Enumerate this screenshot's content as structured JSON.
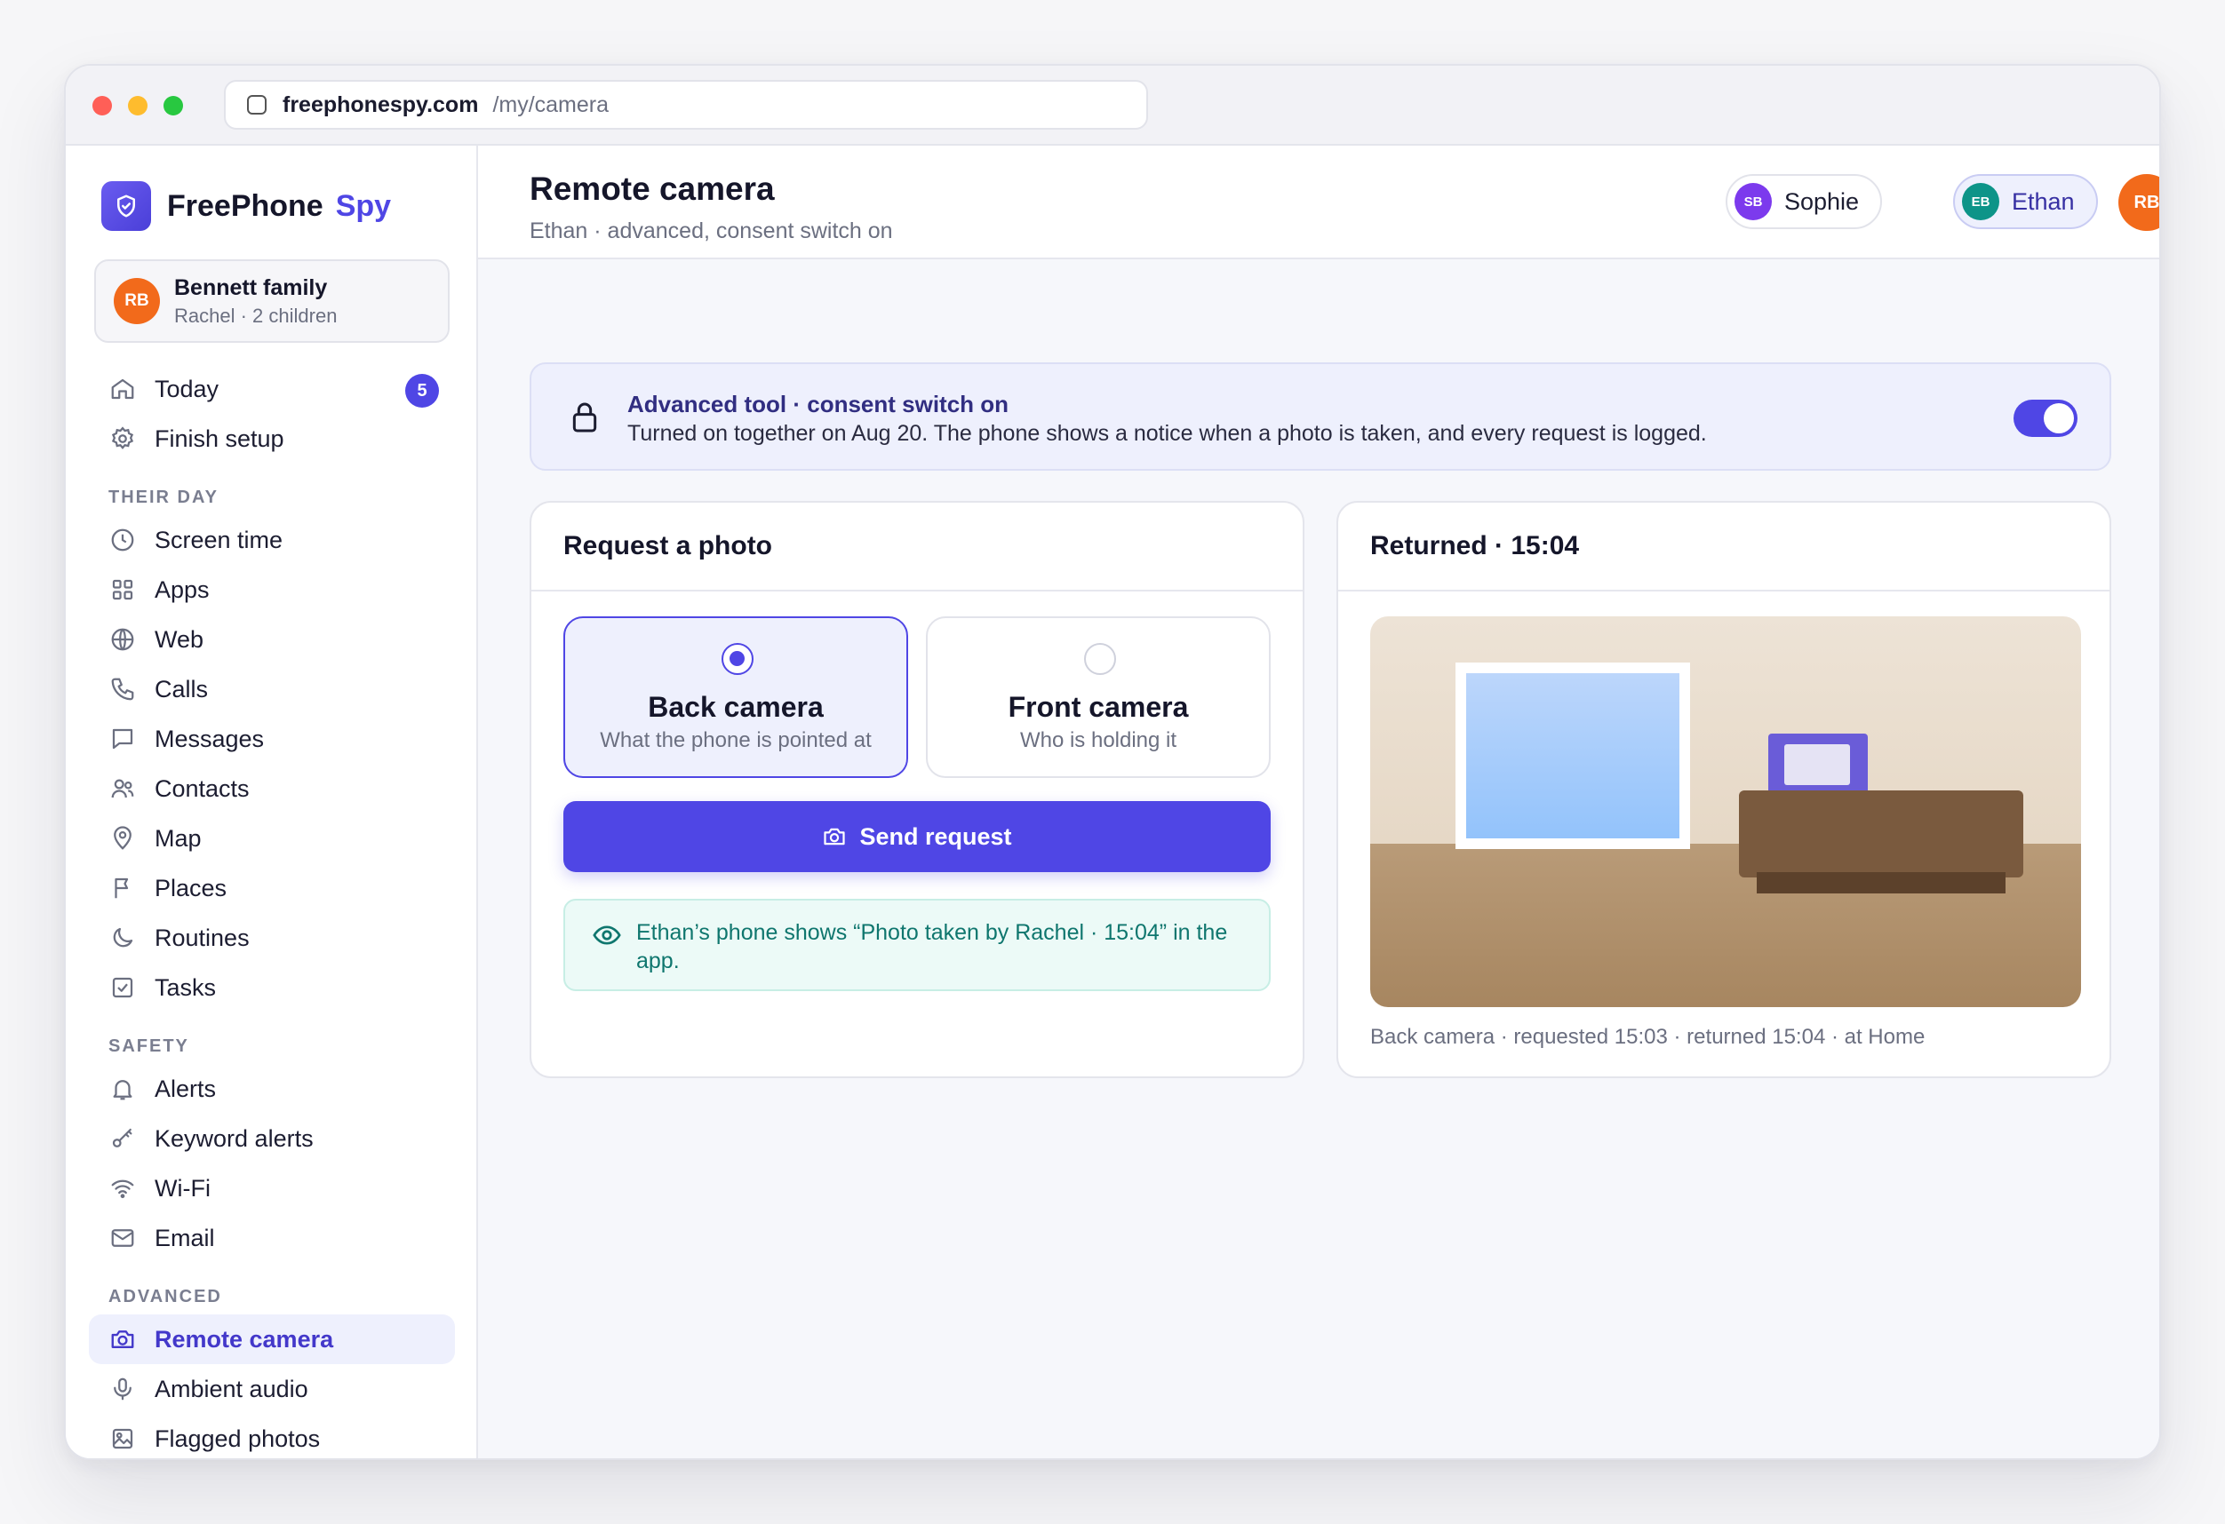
{
  "browser": {
    "host": "freephonespy.com",
    "path": "/my/camera"
  },
  "brand": {
    "name": "FreePhone",
    "accent_word": "Spy",
    "accent_color": "#4f46e5"
  },
  "family": {
    "initials": "RB",
    "name": "Bennett family",
    "detail": "Rachel · 2 children"
  },
  "nav": {
    "top": [
      {
        "label": "Today",
        "icon": "home-icon",
        "badge": "5"
      },
      {
        "label": "Finish setup",
        "icon": "gear-icon"
      }
    ],
    "sections": [
      {
        "title": "THEIR DAY",
        "items": [
          {
            "label": "Screen time",
            "icon": "clock-icon"
          },
          {
            "label": "Apps",
            "icon": "grid-icon"
          },
          {
            "label": "Web",
            "icon": "globe-icon"
          },
          {
            "label": "Calls",
            "icon": "phone-icon"
          },
          {
            "label": "Messages",
            "icon": "message-icon"
          },
          {
            "label": "Contacts",
            "icon": "users-icon"
          },
          {
            "label": "Map",
            "icon": "map-pin-icon"
          },
          {
            "label": "Places",
            "icon": "flag-icon"
          },
          {
            "label": "Routines",
            "icon": "moon-icon"
          },
          {
            "label": "Tasks",
            "icon": "checkbox-icon"
          }
        ]
      },
      {
        "title": "SAFETY",
        "items": [
          {
            "label": "Alerts",
            "icon": "bell-icon"
          },
          {
            "label": "Keyword alerts",
            "icon": "key-icon"
          },
          {
            "label": "Wi-Fi",
            "icon": "wifi-icon"
          },
          {
            "label": "Email",
            "icon": "mail-icon"
          }
        ]
      },
      {
        "title": "ADVANCED",
        "items": [
          {
            "label": "Remote camera",
            "icon": "camera-icon",
            "active": true
          },
          {
            "label": "Ambient audio",
            "icon": "microphone-icon"
          },
          {
            "label": "Flagged photos",
            "icon": "image-icon"
          }
        ]
      }
    ]
  },
  "header": {
    "title": "Remote camera",
    "subtitle": "Ethan · advanced, consent switch on",
    "profiles": [
      {
        "initials": "SB",
        "name": "Sophie"
      },
      {
        "initials": "EB",
        "name": "Ethan",
        "selected": true
      }
    ],
    "user_initials": "RB"
  },
  "consent": {
    "title": "Advanced tool · consent switch on",
    "text": "Turned on together on Aug 20. The phone shows a notice when a photo is taken, and every request is logged.",
    "enabled": true
  },
  "request": {
    "title": "Request a photo",
    "options": [
      {
        "label": "Back camera",
        "desc": "What the phone is pointed at",
        "selected": true
      },
      {
        "label": "Front camera",
        "desc": "Who is holding it",
        "selected": false
      }
    ],
    "send_label": "Send request",
    "notice": "Ethan’s phone shows “Photo taken by Rachel · 15:04” in the app."
  },
  "returned": {
    "title": "Returned · 15:04",
    "caption": "Back camera · requested 15:03 · returned 15:04 · at Home"
  }
}
